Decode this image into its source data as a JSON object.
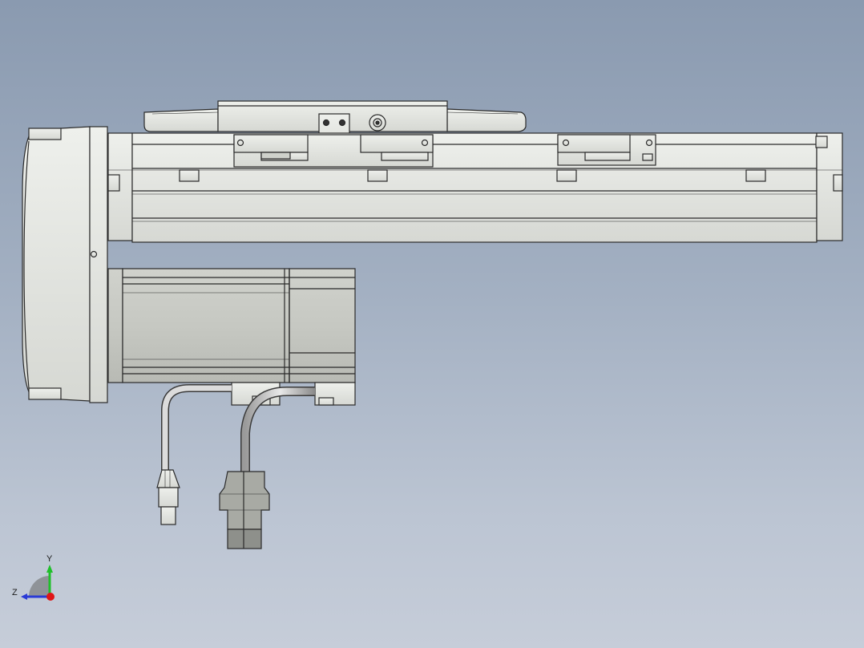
{
  "scene": {
    "background_top": "#8a9ab0",
    "background_bottom": "#c6cdd9",
    "model_fill": "#e4e6e1",
    "model_edge": "#2a2a2a"
  },
  "triad": {
    "axis_y_label": "Y",
    "axis_z_label": "Z",
    "axis_y_color": "#1fbf2a",
    "axis_z_color": "#2a3bd6",
    "origin_color": "#e01616"
  }
}
